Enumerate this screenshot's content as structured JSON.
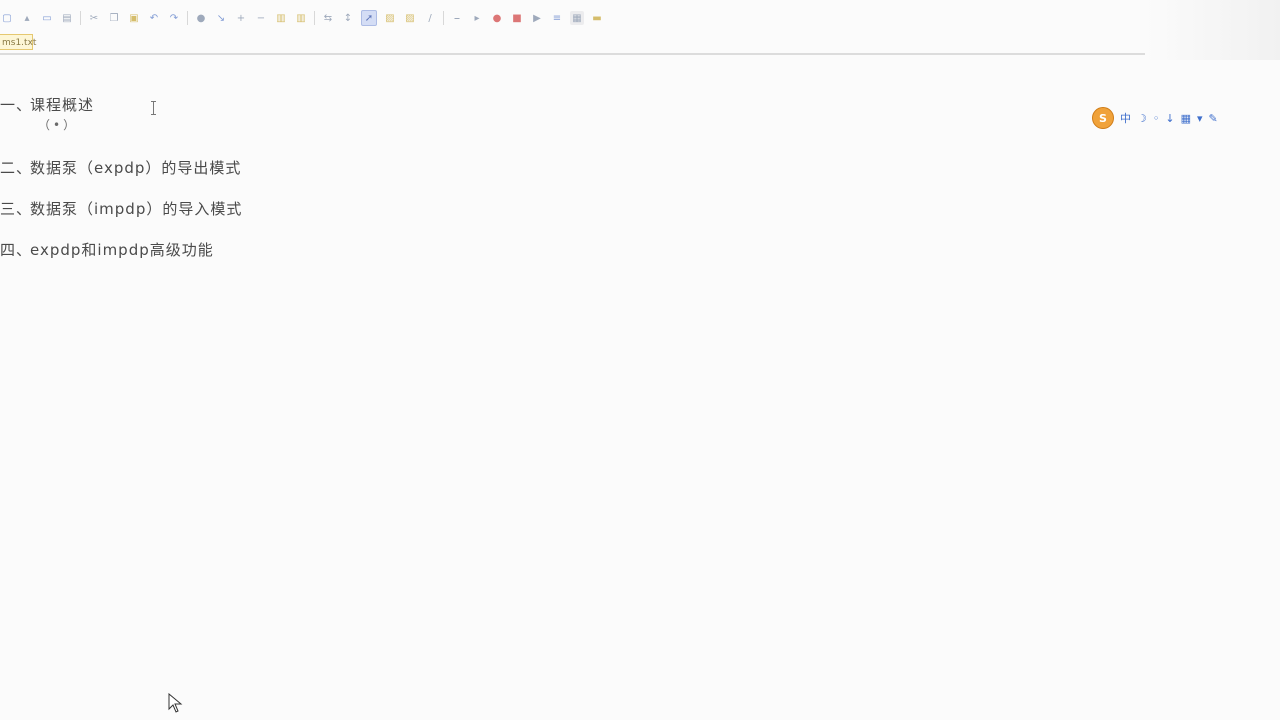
{
  "document_tab": {
    "label": "ms1.txt"
  },
  "outline": {
    "items": [
      {
        "num": "一、",
        "text": "课程概述"
      },
      {
        "num": "二、",
        "text": "数据泵（expdp）的导出模式"
      },
      {
        "num": "三、",
        "text": "数据泵（impdp）的导入模式"
      },
      {
        "num": "四、",
        "text": "expdp和impdp高级功能"
      }
    ],
    "sub_text": "（•）"
  },
  "ime_bar": {
    "logo_label": "S",
    "icons": [
      "中",
      "☽",
      "◦",
      "↓",
      "▦",
      "▾",
      "✎"
    ]
  },
  "toolbar": {
    "icons": [
      "new-icon",
      "open-icon",
      "save-icon",
      "print-icon",
      "cut-icon",
      "copy-icon",
      "paste-icon",
      "undo-icon",
      "redo-icon",
      "find-icon",
      "replace-icon",
      "zoom-in-icon",
      "zoom-out-icon",
      "indent-icon",
      "outdent-icon",
      "wrap-icon",
      "macro-icon",
      "run-icon",
      "record-icon",
      "stop-icon",
      "play-icon",
      "bookmark-icon",
      "highlight-icon"
    ]
  }
}
